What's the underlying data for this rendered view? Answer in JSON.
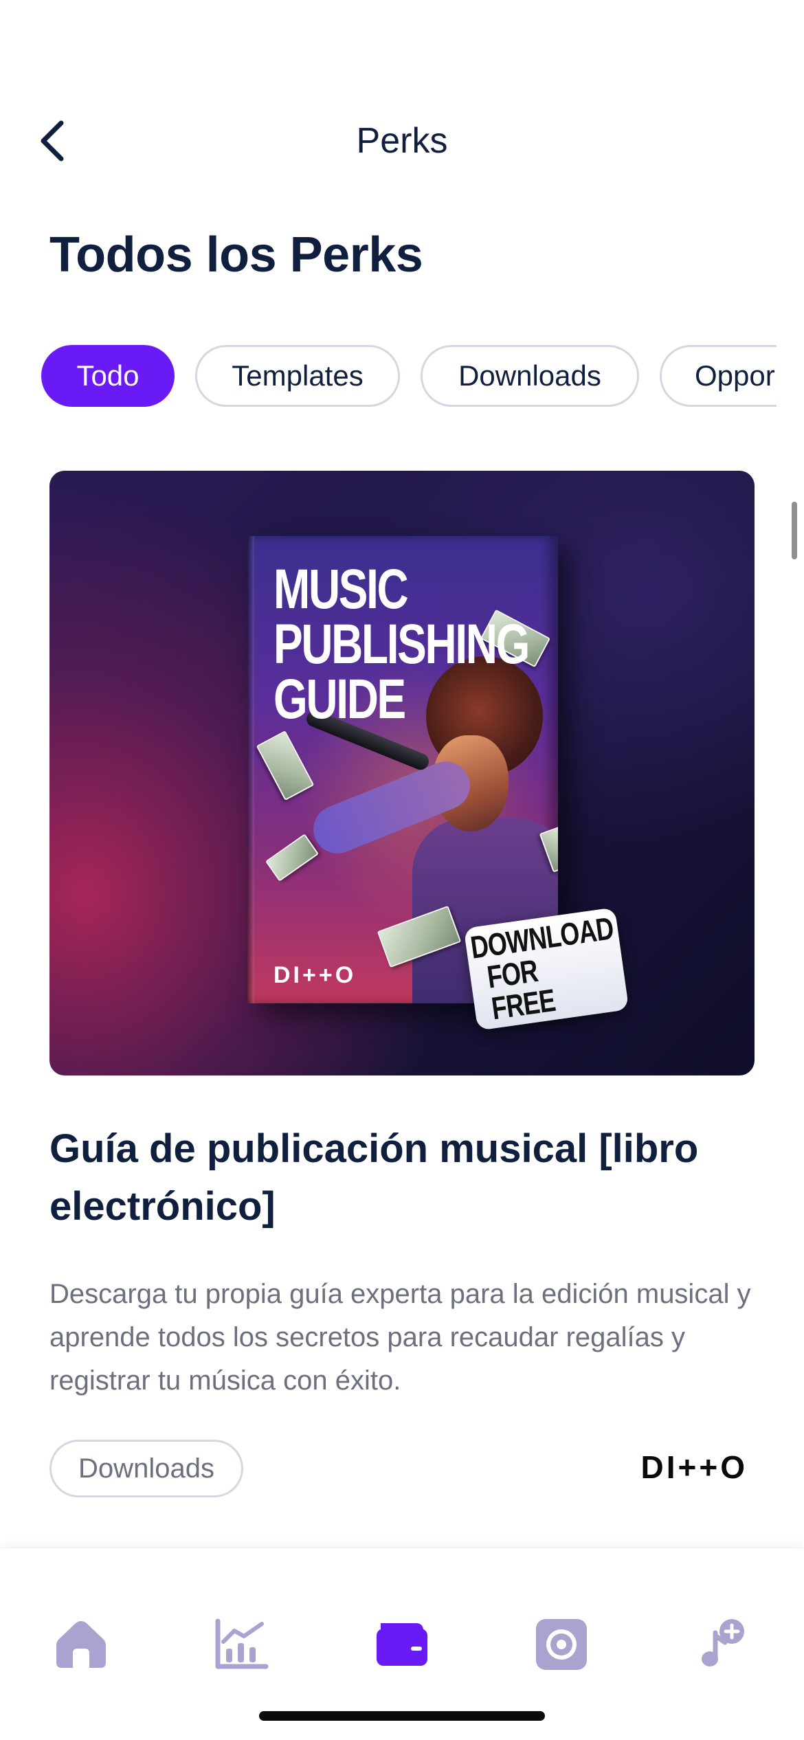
{
  "header": {
    "back_icon": "chevron-left-icon",
    "title": "Perks"
  },
  "section": {
    "title": "Todos los Perks"
  },
  "filters": [
    {
      "label": "Todo",
      "active": true
    },
    {
      "label": "Templates",
      "active": false
    },
    {
      "label": "Downloads",
      "active": false
    },
    {
      "label": "Oppor",
      "active": false
    }
  ],
  "card": {
    "image": {
      "book_title": "MUSIC\nPUBLISHING\nGUIDE",
      "book_logo": "DI++O",
      "sticker_line1": "DOWNLOAD",
      "sticker_line2": "FOR FREE"
    },
    "title": "Guía de publicación musical [libro electrónico]",
    "description": "Descarga tu propia guía experta para la edición musical y aprende todos los secretos para recaudar regalías y registrar tu música con éxito.",
    "tag": "Downloads",
    "brand": "DI++O"
  },
  "bottom_nav": {
    "items": [
      {
        "icon": "home-icon",
        "active": false
      },
      {
        "icon": "analytics-icon",
        "active": false
      },
      {
        "icon": "wallet-icon",
        "active": true
      },
      {
        "icon": "vinyl-record-icon",
        "active": false
      },
      {
        "icon": "add-music-icon",
        "active": false
      }
    ],
    "colors": {
      "active": "#6a1bf5",
      "inactive": "#a8a3cf"
    }
  },
  "colors": {
    "accent": "#6a1bf5",
    "text_primary": "#0f1f3d",
    "text_secondary": "#6b6f7e"
  }
}
